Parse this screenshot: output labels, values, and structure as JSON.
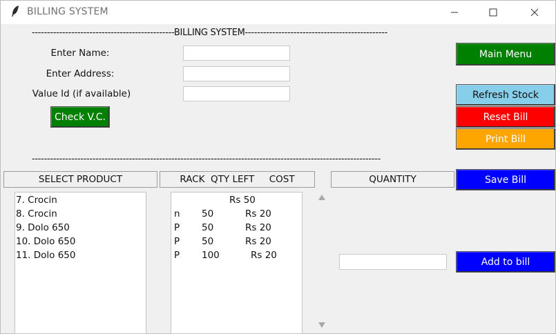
{
  "window": {
    "title": "BILLING SYSTEM",
    "icon": "feather-icon",
    "controls": {
      "minimize": "—",
      "maximize": "☐",
      "close": "✕"
    }
  },
  "header": {
    "rule_text": "-----------------------------------------------BILLING SYSTEM-----------------------------------------------",
    "bottom_rule": "-------------------------------------------------------------------------------------------------------------------"
  },
  "form": {
    "name_label": "Enter Name:",
    "address_label": "Enter Address:",
    "valueid_label": "Value Id (if available)",
    "name_value": "",
    "address_value": "",
    "valueid_value": "",
    "check_button": "Check V.C."
  },
  "side_buttons": {
    "main_menu": "Main Menu",
    "refresh_stock": "Refresh Stock",
    "reset_bill": "Reset Bill",
    "print_bill": "Print Bill",
    "save_bill": "Save Bill",
    "add_to_bill": "Add to bill"
  },
  "table_headers": {
    "select_product": "SELECT PRODUCT",
    "rack_qty_cost": "RACK  QTY LEFT     COST",
    "quantity": "QUANTITY"
  },
  "products": [
    {
      "label": "7. Crocin"
    },
    {
      "label": "8. Crocin"
    },
    {
      "label": "9. Dolo 650"
    },
    {
      "label": "10. Dolo 650"
    },
    {
      "label": "11. Dolo 650"
    }
  ],
  "stock_rows": [
    {
      "rack": "",
      "qty": "",
      "cost": "Rs 50"
    },
    {
      "rack": "n",
      "qty": "50",
      "cost": "Rs 20"
    },
    {
      "rack": "P",
      "qty": "50",
      "cost": "Rs 20"
    },
    {
      "rack": "P",
      "qty": "50",
      "cost": "Rs 20"
    },
    {
      "rack": "P",
      "qty": "100",
      "cost": "Rs 20"
    }
  ],
  "quantity_value": "",
  "colors": {
    "green": "#008000",
    "light_blue": "#87ceeb",
    "red": "#ff0000",
    "orange": "#ffa500",
    "blue": "#0000ff"
  }
}
